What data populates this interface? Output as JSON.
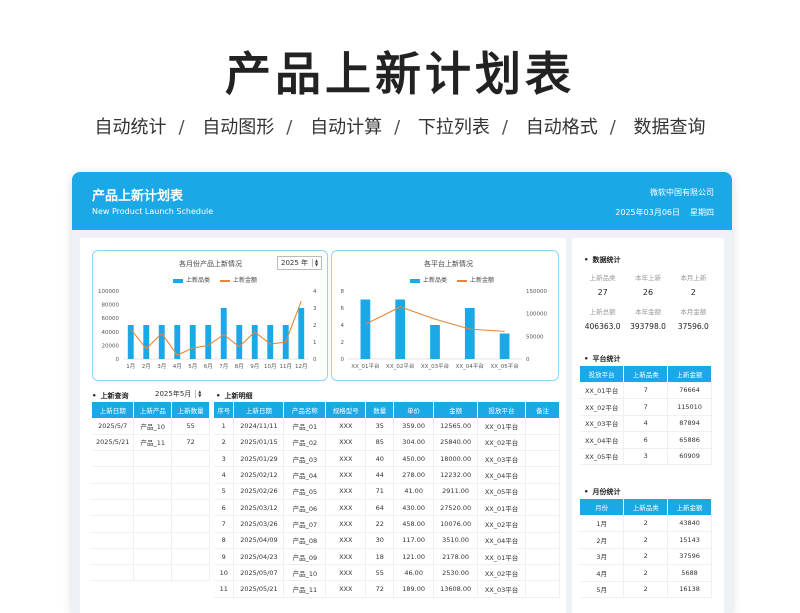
{
  "hero": {
    "title": "产品上新计划表",
    "tags": [
      "自动统计",
      "自动图形",
      "自动计算",
      "下拉列表",
      "自动格式",
      "数据查询"
    ]
  },
  "header": {
    "title": "产品上新计划表",
    "subtitle": "New Product Launch Schedule",
    "company": "微软中国有限公司",
    "date": "2025年03月06日",
    "weekday": "星期四"
  },
  "colors": {
    "accent": "#1aa8e6",
    "line": "#e8853a"
  },
  "chart1": {
    "title": "各月份产品上新情况",
    "year_value": "2025 年",
    "legend_bar": "上新品类",
    "legend_line": "上新金额"
  },
  "chart2": {
    "title": "各平台上新情况",
    "legend_bar": "上新品类",
    "legend_line": "上新金额"
  },
  "chart_data": [
    {
      "type": "bar",
      "title": "各月份产品上新情况",
      "categories": [
        "1月",
        "2月",
        "3月",
        "4月",
        "5月",
        "6月",
        "7月",
        "8月",
        "9月",
        "10月",
        "11月",
        "12月"
      ],
      "y_ticks": [
        "100000",
        "80000",
        "60000",
        "40000",
        "20000",
        "0"
      ],
      "y2_ticks": [
        "4",
        "3",
        "2",
        "1",
        "0"
      ],
      "ylim": [
        0,
        100000
      ],
      "y2lim": [
        0,
        4
      ],
      "series": [
        {
          "name": "上新品类",
          "type": "bar",
          "axis": "right",
          "values": [
            2,
            2,
            2,
            2,
            2,
            2,
            3,
            2,
            2,
            2,
            2,
            3
          ]
        },
        {
          "name": "上新金额",
          "type": "line",
          "axis": "left",
          "values": [
            43840,
            15143,
            37596,
            5688,
            16138,
            20000,
            36000,
            18000,
            40000,
            22000,
            25000,
            85000
          ]
        }
      ]
    },
    {
      "type": "bar",
      "title": "各平台上新情况",
      "categories": [
        "XX_01平台",
        "XX_02平台",
        "XX_03平台",
        "XX_04平台",
        "XX_05平台"
      ],
      "y_ticks": [
        "8",
        "6",
        "4",
        "2",
        "0"
      ],
      "y2_ticks": [
        "150000",
        "100000",
        "50000",
        "0"
      ],
      "ylim": [
        0,
        8
      ],
      "y2lim": [
        0,
        150000
      ],
      "series": [
        {
          "name": "上新品类",
          "type": "bar",
          "axis": "left",
          "values": [
            7,
            7,
            4,
            6,
            3
          ]
        },
        {
          "name": "上新金额",
          "type": "line",
          "axis": "right",
          "values": [
            76664,
            115010,
            87894,
            65886,
            60909
          ]
        }
      ]
    }
  ],
  "query": {
    "title": "上新查询",
    "month_value": "2025年5月",
    "columns": [
      "上新日期",
      "上新产品",
      "上新数量"
    ],
    "rows": [
      [
        "2025/5/7",
        "产品_10",
        "55"
      ],
      [
        "2025/5/21",
        "产品_11",
        "72"
      ],
      [
        "",
        "",
        ""
      ],
      [
        "",
        "",
        ""
      ],
      [
        "",
        "",
        ""
      ],
      [
        "",
        "",
        ""
      ],
      [
        "",
        "",
        ""
      ],
      [
        "",
        "",
        ""
      ],
      [
        "",
        "",
        ""
      ],
      [
        "",
        "",
        ""
      ]
    ]
  },
  "detail": {
    "title": "上新明细",
    "columns": [
      "序号",
      "上新日期",
      "产品名称",
      "规格型号",
      "数量",
      "单价",
      "金额",
      "投放平台",
      "备注"
    ],
    "rows": [
      [
        "1",
        "2024/11/11",
        "产品_01",
        "XXX",
        "35",
        "359.00",
        "12565.00",
        "XX_01平台",
        ""
      ],
      [
        "2",
        "2025/01/15",
        "产品_02",
        "XXX",
        "85",
        "304.00",
        "25840.00",
        "XX_02平台",
        ""
      ],
      [
        "3",
        "2025/01/29",
        "产品_03",
        "XXX",
        "40",
        "450.00",
        "18000.00",
        "XX_03平台",
        ""
      ],
      [
        "4",
        "2025/02/12",
        "产品_04",
        "XXX",
        "44",
        "278.00",
        "12232.00",
        "XX_04平台",
        ""
      ],
      [
        "5",
        "2025/02/26",
        "产品_05",
        "XXX",
        "71",
        "41.00",
        "2911.00",
        "XX_05平台",
        ""
      ],
      [
        "6",
        "2025/03/12",
        "产品_06",
        "XXX",
        "64",
        "430.00",
        "27520.00",
        "XX_01平台",
        ""
      ],
      [
        "7",
        "2025/03/26",
        "产品_07",
        "XXX",
        "22",
        "458.00",
        "10076.00",
        "XX_02平台",
        ""
      ],
      [
        "8",
        "2025/04/09",
        "产品_08",
        "XXX",
        "30",
        "117.00",
        "3510.00",
        "XX_04平台",
        ""
      ],
      [
        "9",
        "2025/04/23",
        "产品_09",
        "XXX",
        "18",
        "121.00",
        "2178.00",
        "XX_01平台",
        ""
      ],
      [
        "10",
        "2025/05/07",
        "产品_10",
        "XXX",
        "55",
        "46.00",
        "2530.00",
        "XX_02平台",
        ""
      ],
      [
        "11",
        "2025/05/21",
        "产品_11",
        "XXX",
        "72",
        "189.00",
        "13608.00",
        "XX_03平台",
        ""
      ]
    ]
  },
  "stats": {
    "title": "数据统计",
    "labels1": [
      "上新品类",
      "本年上新",
      "本月上新"
    ],
    "values1": [
      "27",
      "26",
      "2"
    ],
    "labels2": [
      "上新总额",
      "本年金额",
      "本月金额"
    ],
    "values2": [
      "406363.0",
      "393798.0",
      "37596.0"
    ]
  },
  "platform": {
    "title": "平台统计",
    "columns": [
      "投放平台",
      "上新品类",
      "上新金额"
    ],
    "rows": [
      [
        "XX_01平台",
        "7",
        "76664"
      ],
      [
        "XX_02平台",
        "7",
        "115010"
      ],
      [
        "XX_03平台",
        "4",
        "87894"
      ],
      [
        "XX_04平台",
        "6",
        "65886"
      ],
      [
        "XX_05平台",
        "3",
        "60909"
      ]
    ]
  },
  "monthly": {
    "title": "月份统计",
    "columns": [
      "月份",
      "上新品类",
      "上新金额"
    ],
    "rows": [
      [
        "1月",
        "2",
        "43840"
      ],
      [
        "2月",
        "2",
        "15143"
      ],
      [
        "3月",
        "2",
        "37596"
      ],
      [
        "4月",
        "2",
        "5688"
      ],
      [
        "5月",
        "2",
        "16138"
      ]
    ]
  }
}
